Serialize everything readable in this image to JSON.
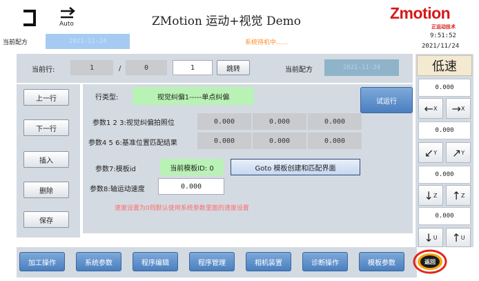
{
  "header": {
    "title": "ZMotion 运动+视觉 Demo",
    "auto_label": "Auto",
    "recipe_label": "当前配方",
    "recipe_value": "2021-11-24",
    "status": "系统待机中......",
    "brand": "Zmotion",
    "brand_sub": "正运动技术",
    "time": "9:51:52",
    "date": "2021/11/24"
  },
  "row_bar": {
    "current_row_label": "当前行:",
    "current_row": "1",
    "slash": "/",
    "total_rows": "0",
    "jump_input": "1",
    "jump_button": "跳转",
    "recipe_label": "当前配方",
    "recipe_value": "2021-11-24"
  },
  "left_buttons": [
    "上一行",
    "下一行",
    "插入",
    "删除",
    "保存"
  ],
  "form": {
    "type_label": "行类型:",
    "type_value": "视觉纠偏1-----单点纠偏",
    "run_button": "试运行",
    "params123_label": "参数1 2 3:视觉纠偏拍照位",
    "params123": [
      "0.000",
      "0.000",
      "0.000"
    ],
    "params456_label": "参数4 5 6:基准位置匹配结果",
    "params456": [
      "0.000",
      "0.000",
      "0.000"
    ],
    "param7_label": "参数7:模板id",
    "param7_value": "当前模板ID: 0",
    "goto_button": "Goto 模板创建和匹配界面",
    "param8_label": "参数8:轴运动速度",
    "param8_value": "0.000",
    "note": "速度设置为0则默认使用系统参数里面的速度设置"
  },
  "right_panel": {
    "speed_label": "低速",
    "axes": [
      {
        "value": "0.000",
        "minus": "←",
        "plus": "→",
        "axis": "X"
      },
      {
        "value": "0.000",
        "minus": "↙",
        "plus": "↗",
        "axis": "Y"
      },
      {
        "value": "0.000",
        "minus": "↓",
        "plus": "↑",
        "axis": "Z"
      },
      {
        "value": "0.000",
        "minus": "↓",
        "plus": "↑",
        "axis": "U"
      }
    ],
    "back_button": "返回"
  },
  "bottom_nav": [
    "加工操作",
    "系统参数",
    "程序编辑",
    "程序管理",
    "相机装置",
    "诊断操作",
    "模板参数"
  ],
  "colors": {
    "panel": "#d4dae2",
    "green_field": "#b9f2b5",
    "recipe_field": "#a6cbf2",
    "status_text": "#ff8a2a",
    "brand_red": "#d61818",
    "nav_blue": "#4a7fbf"
  }
}
